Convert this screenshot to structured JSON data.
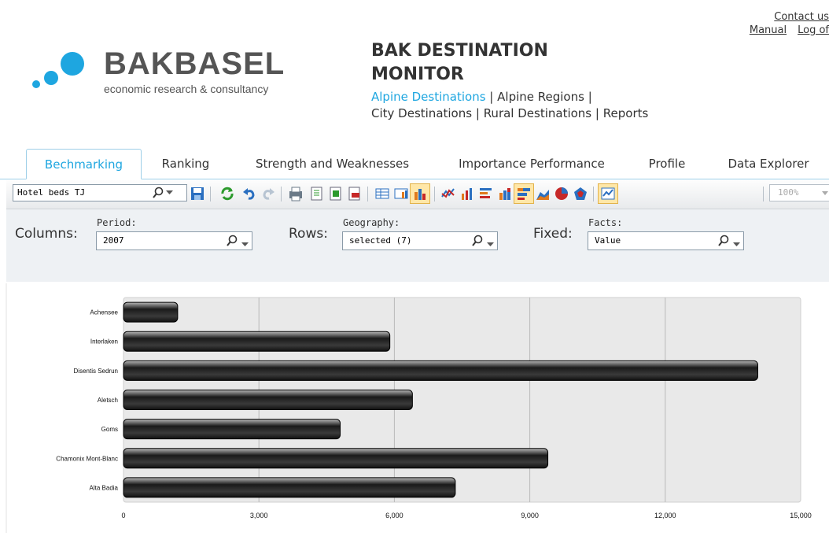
{
  "header": {
    "links": {
      "contact": "Contact us",
      "manual": "Manual",
      "logout": "Log of"
    },
    "logo": {
      "brand": "BAKBASEL",
      "tagline": "economic research & consultancy"
    },
    "title_line1": "BAK DESTINATION",
    "title_line2": "MONITOR",
    "dest_links": {
      "alpine_destinations": "Alpine Destinations",
      "alpine_regions": "Alpine Regions",
      "city_destinations": "City Destinations",
      "rural_destinations": "Rural Destinations",
      "reports": "Reports",
      "separator": "|"
    }
  },
  "tabs": [
    {
      "label": "Bechmarking",
      "active": true
    },
    {
      "label": "Ranking",
      "active": false
    },
    {
      "label": "Strength and Weaknesses",
      "active": false
    },
    {
      "label": "Importance Performance",
      "active": false
    },
    {
      "label": "Profile",
      "active": false
    },
    {
      "label": "Data Explorer",
      "active": false
    }
  ],
  "toolbar": {
    "measure_value": "Hotel beds TJ",
    "zoom_value": "100%",
    "icons": [
      "search-icon",
      "dropdown-arrow-icon",
      "save-icon",
      "refresh-icon",
      "undo-icon",
      "redo-icon",
      "print-icon",
      "export-icon",
      "export-excel-icon",
      "export-pdf-icon",
      "table-view-icon",
      "table-chart-view-icon",
      "chart-view-icon",
      "line-chart-icon",
      "column-chart-icon",
      "bar-chart-icon",
      "stacked-column-icon",
      "stacked-bar-icon",
      "area-chart-icon",
      "pie-chart-icon",
      "radar-chart-icon",
      "chart-settings-icon"
    ]
  },
  "filters": {
    "columns_label": "Columns:",
    "period_label": "Period:",
    "period_value": "2007",
    "rows_label": "Rows:",
    "geography_label": "Geography:",
    "geography_value": "selected (7)",
    "fixed_label": "Fixed:",
    "facts_label": "Facts:",
    "facts_value": "Value"
  },
  "chart_data": {
    "type": "bar",
    "orientation": "horizontal",
    "categories": [
      "Achensee",
      "Interlaken",
      "Disentis Sedrun",
      "Aletsch",
      "Goms",
      "Chamonix Mont-Blanc",
      "Alta Badia"
    ],
    "values": [
      1200,
      5900,
      14050,
      6400,
      4800,
      9400,
      7350
    ],
    "xlim": [
      0,
      15000
    ],
    "ticks": [
      "0",
      "3,000",
      "6,000",
      "9,000",
      "12,000",
      "15,000"
    ],
    "tick_values": [
      0,
      3000,
      6000,
      9000,
      12000,
      15000
    ],
    "grid": true,
    "bar_color": "#2a2a2a",
    "plot_background": "#e9e9e9",
    "legend": "none"
  },
  "colors": {
    "accent": "#1ea6e0",
    "tab_border": "#9ecfe8"
  }
}
